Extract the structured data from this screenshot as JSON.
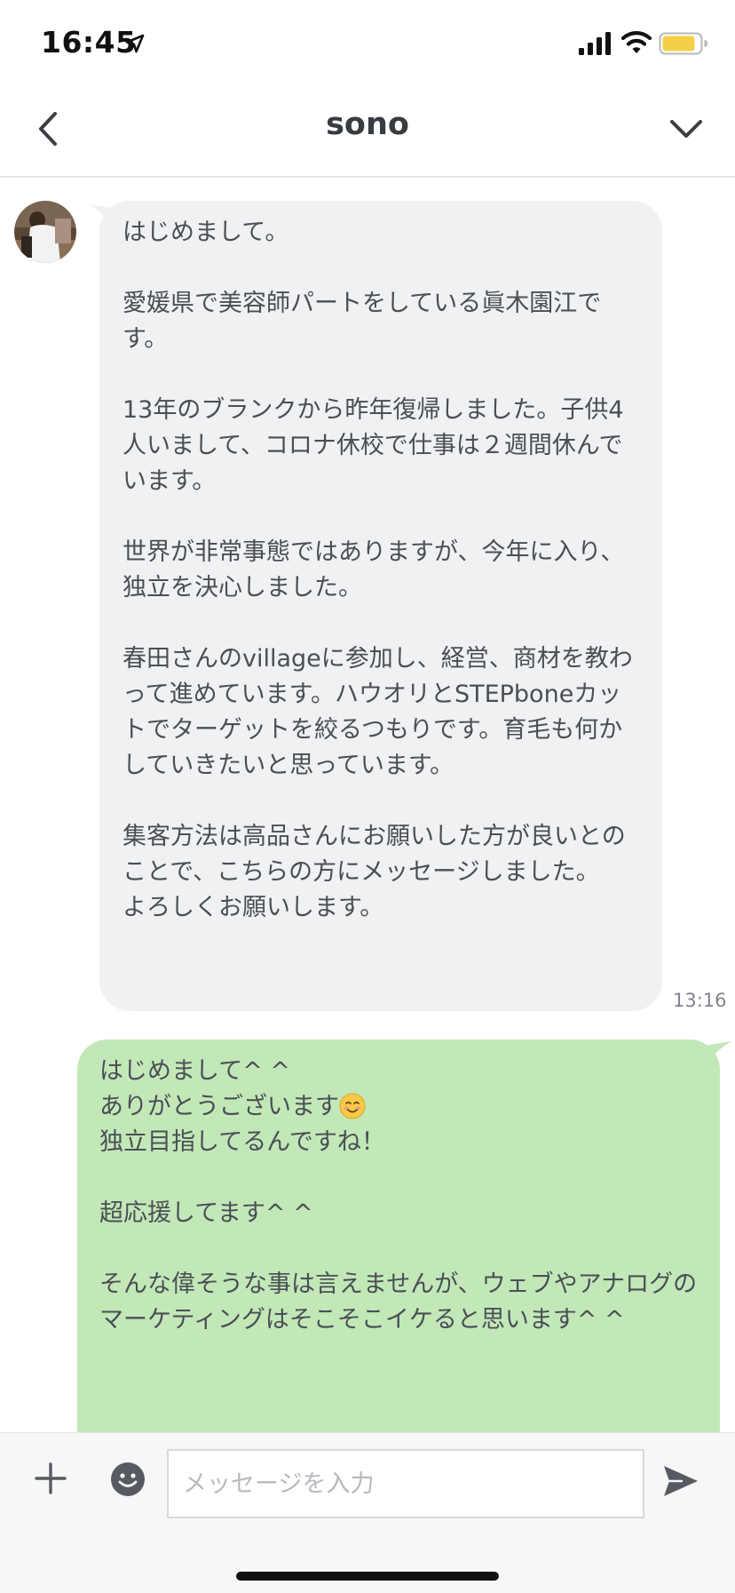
{
  "status_bar": {
    "time": "16:45"
  },
  "nav": {
    "title": "sono"
  },
  "messages": [
    {
      "direction": "incoming",
      "text": "はじめまして。\n\n愛媛県で美容師パートをしている眞木園江です。\n\n13年のブランクから昨年復帰しました。子供4人いまして、コロナ休校で仕事は２週間休んでいます。\n\n世界が非常事態ではありますが、今年に入り、独立を決心しました。\n\n春田さんのvillageに参加し、経営、商材を教わって進めています。ハウオリとSTEPboneカットでターゲットを絞るつもりです。育毛も何かしていきたいと思っています。\n\n集客方法は高品さんにお願いした方が良いとのことで、こちらの方にメッセージしました。\nよろしくお願いします。",
      "time": "13:16"
    },
    {
      "direction": "outgoing",
      "line1": "はじめまして^ ^",
      "line2": "ありがとうございます",
      "emoji": "smiling-face-emoji",
      "rest": "\n独立目指してるんですね！\n\n超応援してます^ ^\n\nそんな偉そうな事は言えませんが、ウェブやアナログのマーケティングはそこそこイケると思います^ ^"
    }
  ],
  "input": {
    "placeholder": "メッセージを入力"
  },
  "colors": {
    "incoming_bubble": "#f0f1f3",
    "outgoing_bubble": "#c2e8b8",
    "battery": "#f6cf48"
  }
}
